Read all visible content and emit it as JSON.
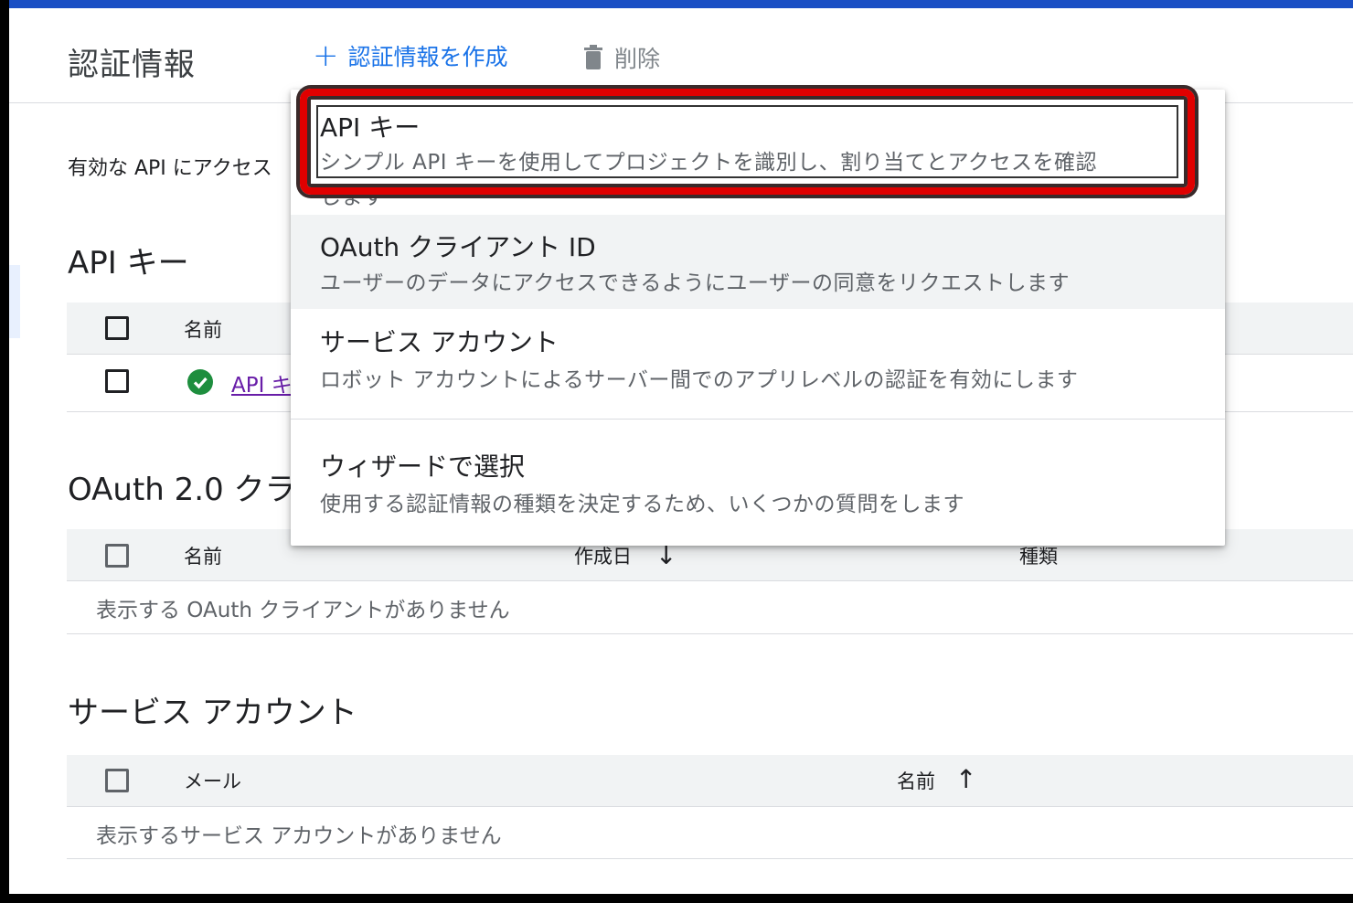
{
  "header": {
    "title": "認証情報",
    "create_label": "認証情報を作成",
    "delete_label": "削除"
  },
  "description": "有効な API にアクセス",
  "api_keys": {
    "title": "API キー",
    "col_name": "名前",
    "row_link": "API キ"
  },
  "oauth": {
    "title": "OAuth 2.0 クラ",
    "col_name": "名前",
    "col_created": "作成日",
    "col_type": "種類",
    "empty": "表示する OAuth クライアントがありません"
  },
  "service_accounts": {
    "title": "サービス アカウント",
    "col_email": "メール",
    "col_name": "名前",
    "empty": "表示するサービス アカウントがありません"
  },
  "menu": {
    "items": [
      {
        "title": "API キー",
        "subtitle": "シンプル API キーを使用してプロジェクトを識別し、割り当てとアクセスを確認",
        "subtitle_cont": "します"
      },
      {
        "title": "OAuth クライアント ID",
        "subtitle": "ユーザーのデータにアクセスできるようにユーザーの同意をリクエストします"
      },
      {
        "title": "サービス アカウント",
        "subtitle": "ロボット アカウントによるサーバー間でのアプリレベルの認証を有効にします"
      },
      {
        "title": "ウィザードで選択",
        "subtitle": "使用する認証情報の種類を決定するため、いくつかの質問をします"
      }
    ]
  },
  "colors": {
    "accent": "#1a73e8",
    "highlight": "#e00000",
    "success": "#1e8e3e",
    "link_visited": "#681da8"
  }
}
